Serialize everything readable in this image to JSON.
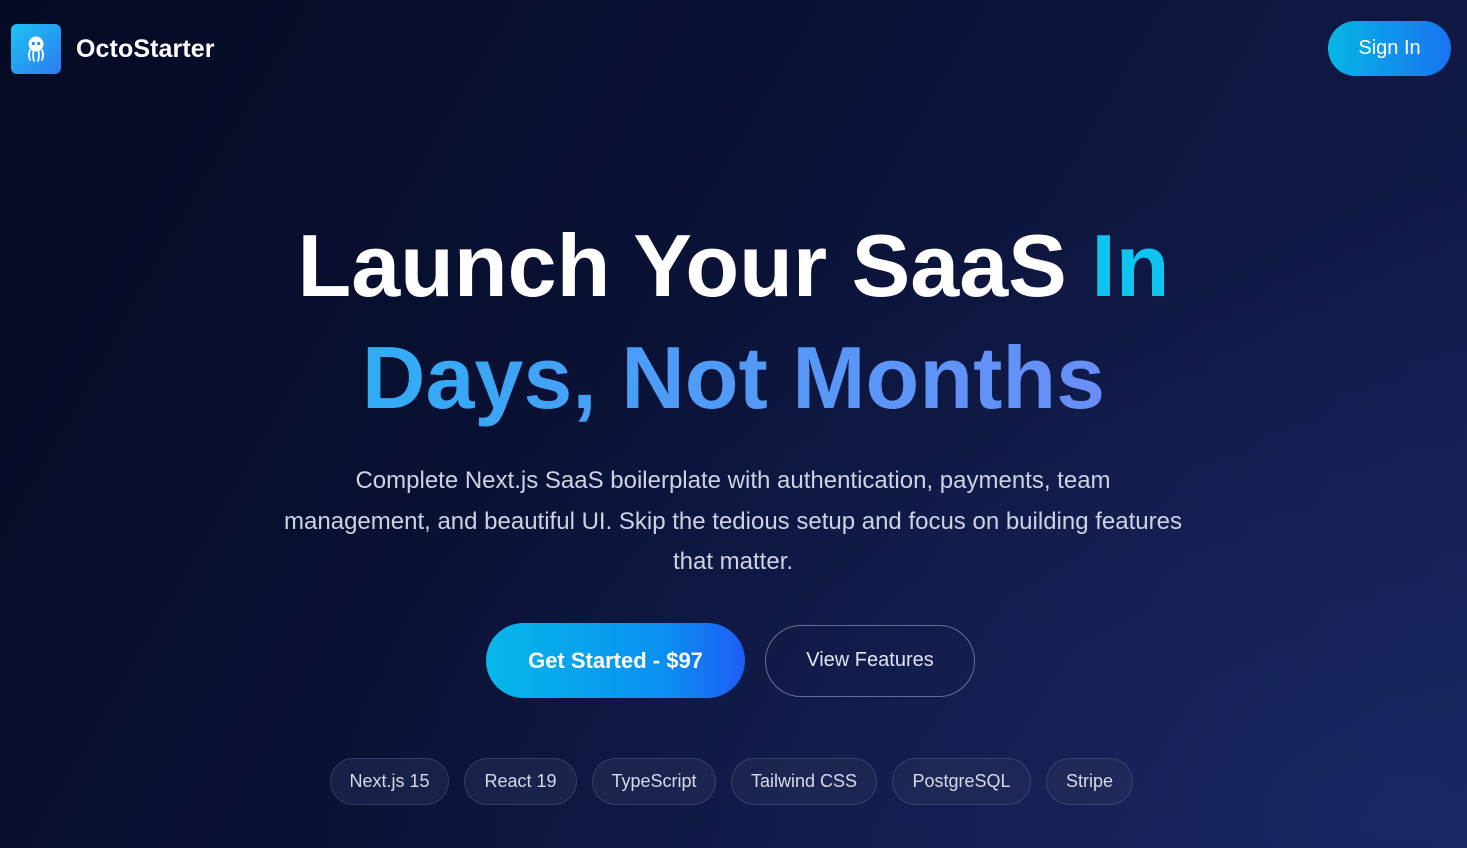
{
  "header": {
    "brand_name": "OctoStarter",
    "logo_icon": "octopus-icon",
    "sign_in_label": "Sign In"
  },
  "hero": {
    "title_part_white": "Launch Your SaaS ",
    "title_part_accent": "In",
    "title_line2": "Days, Not Months",
    "description": "Complete Next.js SaaS boilerplate with authentication, payments, team management, and beautiful UI. Skip the tedious setup and focus on building features that matter."
  },
  "cta": {
    "primary_label": "Get Started - $97",
    "secondary_label": "View Features"
  },
  "tech_stack": [
    "Next.js 15",
    "React 19",
    "TypeScript",
    "Tailwind CSS",
    "PostgreSQL",
    "Stripe"
  ],
  "colors": {
    "background": "#0a1236",
    "accent_cyan": "#0fc4ef",
    "accent_blue": "#1a73f0",
    "accent_violet": "#7e84f6"
  }
}
